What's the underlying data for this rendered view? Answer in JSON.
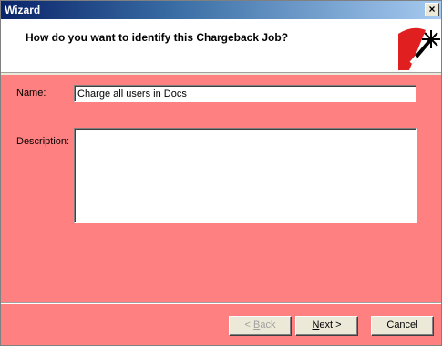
{
  "window": {
    "title": "Wizard",
    "close_glyph": "×"
  },
  "header": {
    "question": "How do you want to identify this Chargeback Job?",
    "icon": "magic-wand-icon"
  },
  "form": {
    "name_label": "Name:",
    "name_value": "Charge all users in Docs",
    "description_label": "Description:",
    "description_value": ""
  },
  "buttons": {
    "back": {
      "prefix": "< ",
      "accel": "B",
      "rest": "ack"
    },
    "next": {
      "accel": "N",
      "rest": "ext >"
    },
    "cancel": "Cancel"
  },
  "colors": {
    "panel": "#ff8080",
    "titlebar": "#0a246a"
  }
}
